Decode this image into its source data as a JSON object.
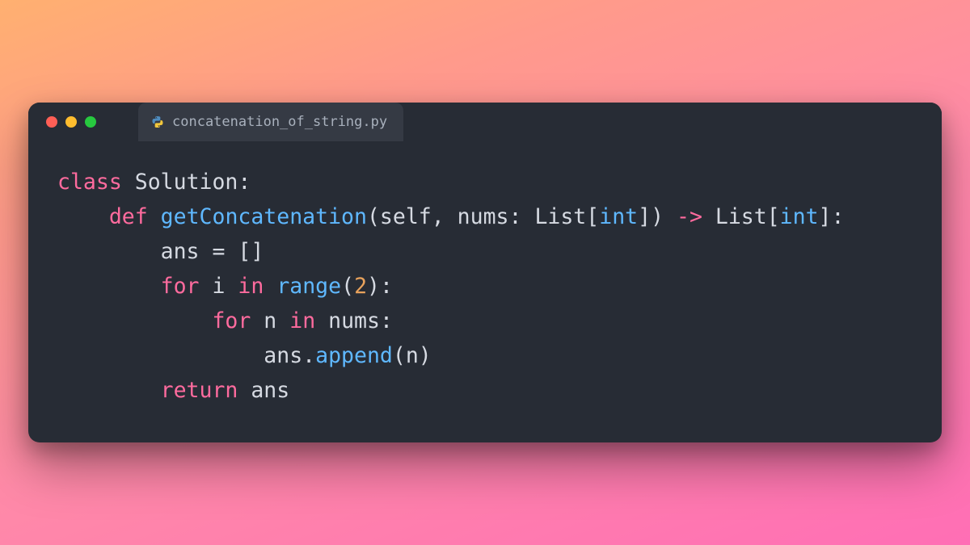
{
  "window": {
    "traffic_lights": {
      "red": "#ff5f56",
      "yellow": "#ffbd2e",
      "green": "#27c93f"
    }
  },
  "tab": {
    "icon": "python-icon",
    "filename": "concatenation_of_string.py"
  },
  "code": {
    "language": "python",
    "tokens": {
      "class": "class",
      "Solution": "Solution",
      "colon": ":",
      "def": "def",
      "getConcatenation": "getConcatenation",
      "lparen": "(",
      "self": "self",
      "comma_sp": ", ",
      "nums": "nums",
      "List": "List",
      "lbrack": "[",
      "int": "int",
      "rbrack": "]",
      "rparen": ")",
      "arrow": " -> ",
      "ans": "ans",
      "eq": " = ",
      "empty_list": "[]",
      "for": "for",
      "i": "i",
      "in": "in",
      "range": "range",
      "two": "2",
      "n": "n",
      "dot": ".",
      "append": "append",
      "return": "return"
    },
    "plain_source": "class Solution:\n    def getConcatenation(self, nums: List[int]) -> List[int]:\n        ans = []\n        for i in range(2):\n            for n in nums:\n                ans.append(n)\n        return ans"
  }
}
